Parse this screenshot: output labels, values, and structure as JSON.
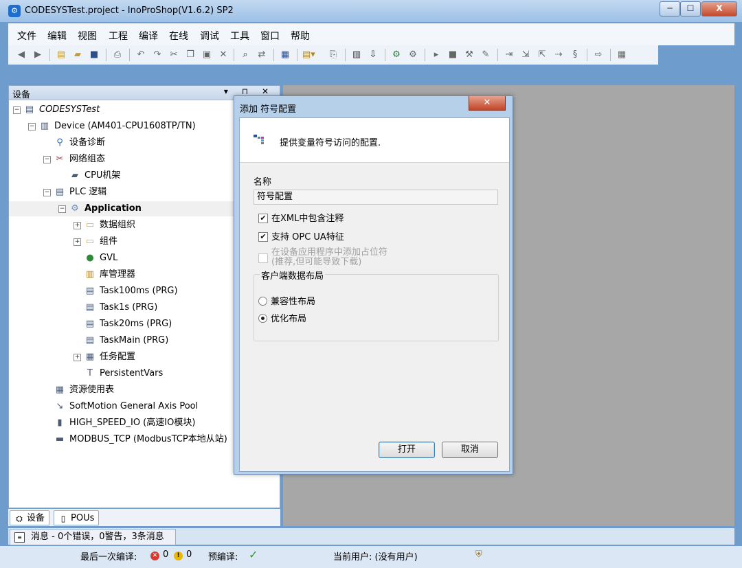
{
  "window": {
    "title": "CODESYSTest.project - InoProShop(V1.6.2) SP2",
    "controls": {
      "minimize": "─",
      "maximize": "☐",
      "close": "X"
    }
  },
  "menu": [
    "文件",
    "编辑",
    "视图",
    "工程",
    "编译",
    "在线",
    "调试",
    "工具",
    "窗口",
    "帮助"
  ],
  "toolbar_icons": [
    "back-icon",
    "forward-icon",
    "new-icon",
    "open-icon",
    "save-icon",
    "print-icon",
    "undo-icon",
    "redo-icon",
    "cut-icon",
    "copy-icon",
    "paste-icon",
    "delete-icon",
    "find-icon",
    "replace-icon",
    "window-icon",
    "add-object-icon",
    "insert-icon",
    "build-icon",
    "generate-code-icon",
    "login-icon",
    "logout-icon",
    "start-icon",
    "stop-icon",
    "reset-icon",
    "breakpoint-icon",
    "step-over-icon",
    "step-into-icon",
    "step-out-icon",
    "run-to-cursor-icon",
    "set-next-icon",
    "show-callstack-icon",
    "write-values-icon"
  ],
  "devices_panel": {
    "title": "设备",
    "controls": "▾ ⊓ ✕",
    "tree": [
      {
        "label": "CODESYSTest",
        "italic": true,
        "indent": 0,
        "expander": "-",
        "icon": "project-icon"
      },
      {
        "label": "Device (AM401-CPU1608TP/TN)",
        "indent": 1,
        "expander": "-",
        "icon": "device-icon"
      },
      {
        "label": "设备诊断",
        "indent": 2,
        "expander": "",
        "icon": "diagnosis-icon"
      },
      {
        "label": "网络组态",
        "indent": 2,
        "expander": "-",
        "icon": "network-icon"
      },
      {
        "label": "CPU机架",
        "indent": 3,
        "expander": "",
        "icon": "rack-icon"
      },
      {
        "label": "PLC 逻辑",
        "indent": 2,
        "expander": "-",
        "icon": "plc-logic-icon"
      },
      {
        "label": "Application",
        "indent": 3,
        "expander": "-",
        "icon": "application-icon",
        "bold": true,
        "selected": true
      },
      {
        "label": "数据组织",
        "indent": 4,
        "expander": "+",
        "icon": "folder-icon"
      },
      {
        "label": "组件",
        "indent": 4,
        "expander": "+",
        "icon": "folder-icon"
      },
      {
        "label": "GVL",
        "indent": 4,
        "expander": "",
        "icon": "gvl-icon"
      },
      {
        "label": "库管理器",
        "indent": 4,
        "expander": "",
        "icon": "library-icon"
      },
      {
        "label": "Task100ms (PRG)",
        "indent": 4,
        "expander": "",
        "icon": "program-icon"
      },
      {
        "label": "Task1s (PRG)",
        "indent": 4,
        "expander": "",
        "icon": "program-icon"
      },
      {
        "label": "Task20ms (PRG)",
        "indent": 4,
        "expander": "",
        "icon": "program-icon"
      },
      {
        "label": "TaskMain (PRG)",
        "indent": 4,
        "expander": "",
        "icon": "program-icon"
      },
      {
        "label": "任务配置",
        "indent": 4,
        "expander": "+",
        "icon": "task-config-icon"
      },
      {
        "label": "PersistentVars",
        "indent": 4,
        "expander": "",
        "icon": "persistent-icon"
      },
      {
        "label": "资源使用表",
        "indent": 2,
        "expander": "",
        "icon": "table-icon"
      },
      {
        "label": "SoftMotion General Axis Pool",
        "indent": 2,
        "expander": "",
        "icon": "axis-icon"
      },
      {
        "label": "HIGH_SPEED_IO (高速IO模块)",
        "indent": 2,
        "expander": "",
        "icon": "module-icon"
      },
      {
        "label": "MODBUS_TCP (ModbusTCP本地从站)",
        "indent": 2,
        "expander": "",
        "icon": "modbus-icon"
      }
    ]
  },
  "bottom_tabs": [
    {
      "label": "设备",
      "icon": "devices-icon"
    },
    {
      "label": "POUs",
      "icon": "pous-icon"
    }
  ],
  "messages": {
    "label": "消息 - 0个错误，0警告，3条消息"
  },
  "status": {
    "last_build_label": "最后一次编译:",
    "errors": "0",
    "warnings": "0",
    "precompile_label": "预编译:",
    "precompile_ok": "✓",
    "current_user": "当前用户: (没有用户)"
  },
  "dialog": {
    "title": "添加 符号配置",
    "close": "✕",
    "description": "提供变量符号访问的配置.",
    "name_label": "名称",
    "name_value": "符号配置",
    "checkboxes": [
      {
        "label": "在XML中包含注释",
        "checked": true,
        "enabled": true
      },
      {
        "label": "支持 OPC UA特征",
        "checked": true,
        "enabled": true
      },
      {
        "label": "在设备应用程序中添加占位符",
        "sublabel": "(推荐,但可能导致下载)",
        "checked": false,
        "enabled": false
      }
    ],
    "layout_group": {
      "title": "客户端数据布局",
      "options": [
        {
          "label": "兼容性布局",
          "checked": false
        },
        {
          "label": "优化布局",
          "checked": true
        }
      ]
    },
    "buttons": {
      "open": "打开",
      "cancel": "取消"
    }
  },
  "colors": {
    "titlebar": "#9cc0e6",
    "workspace": "#a7a7a7",
    "close_red": "#c44a2d",
    "ok_green": "#2c9b2c",
    "error_red": "#d73a2f",
    "warning_yellow": "#e9b700"
  }
}
